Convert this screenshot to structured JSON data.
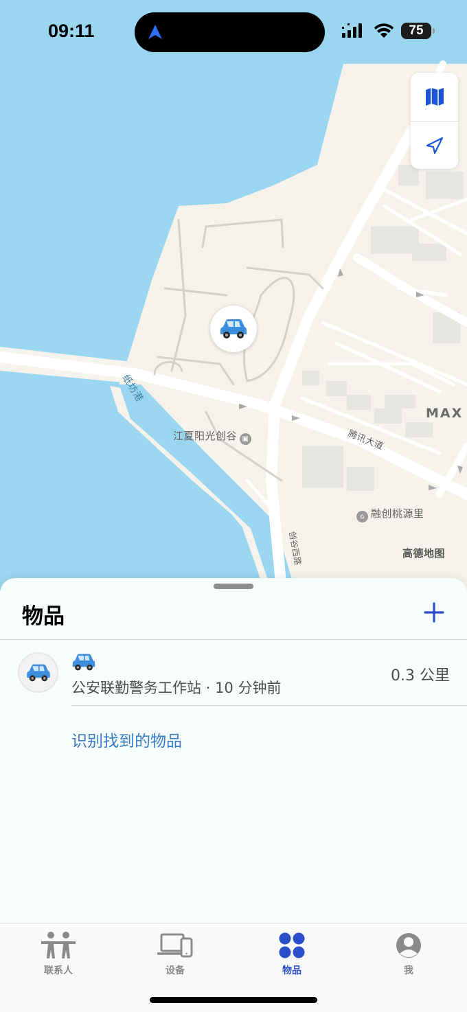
{
  "status_bar": {
    "time": "09:11",
    "battery": "75"
  },
  "map": {
    "labels": {
      "canal": "纸坊港",
      "sunshine_valley": "江夏阳光创谷",
      "tencent_avenue": "腾讯大道",
      "max": "MAX 科",
      "rongchuang": "融创桃源里",
      "chuanggu_west_road": "创谷西路",
      "provider": "高德地图"
    },
    "pin_icon": "car-emoji",
    "controls": [
      "map-icon",
      "location-arrow-icon"
    ]
  },
  "sheet": {
    "title": "物品",
    "add_icon": "plus-icon",
    "items": [
      {
        "name_emoji": "🚙",
        "location": "公安联勤警务工作站",
        "separator": "·",
        "time": "10 分钟前",
        "distance": "0.3 公里"
      }
    ],
    "identify_link": "识别找到的物品"
  },
  "tabs": [
    {
      "label": "联系人",
      "icon": "people-icon",
      "active": false
    },
    {
      "label": "设备",
      "icon": "devices-icon",
      "active": false
    },
    {
      "label": "物品",
      "icon": "items-icon",
      "active": true
    },
    {
      "label": "我",
      "icon": "person-circle-icon",
      "active": false
    }
  ],
  "colors": {
    "accent": "#2a4fc9",
    "water": "#9bd6f0",
    "land": "#f6f3ec",
    "link": "#3a7cc4"
  }
}
